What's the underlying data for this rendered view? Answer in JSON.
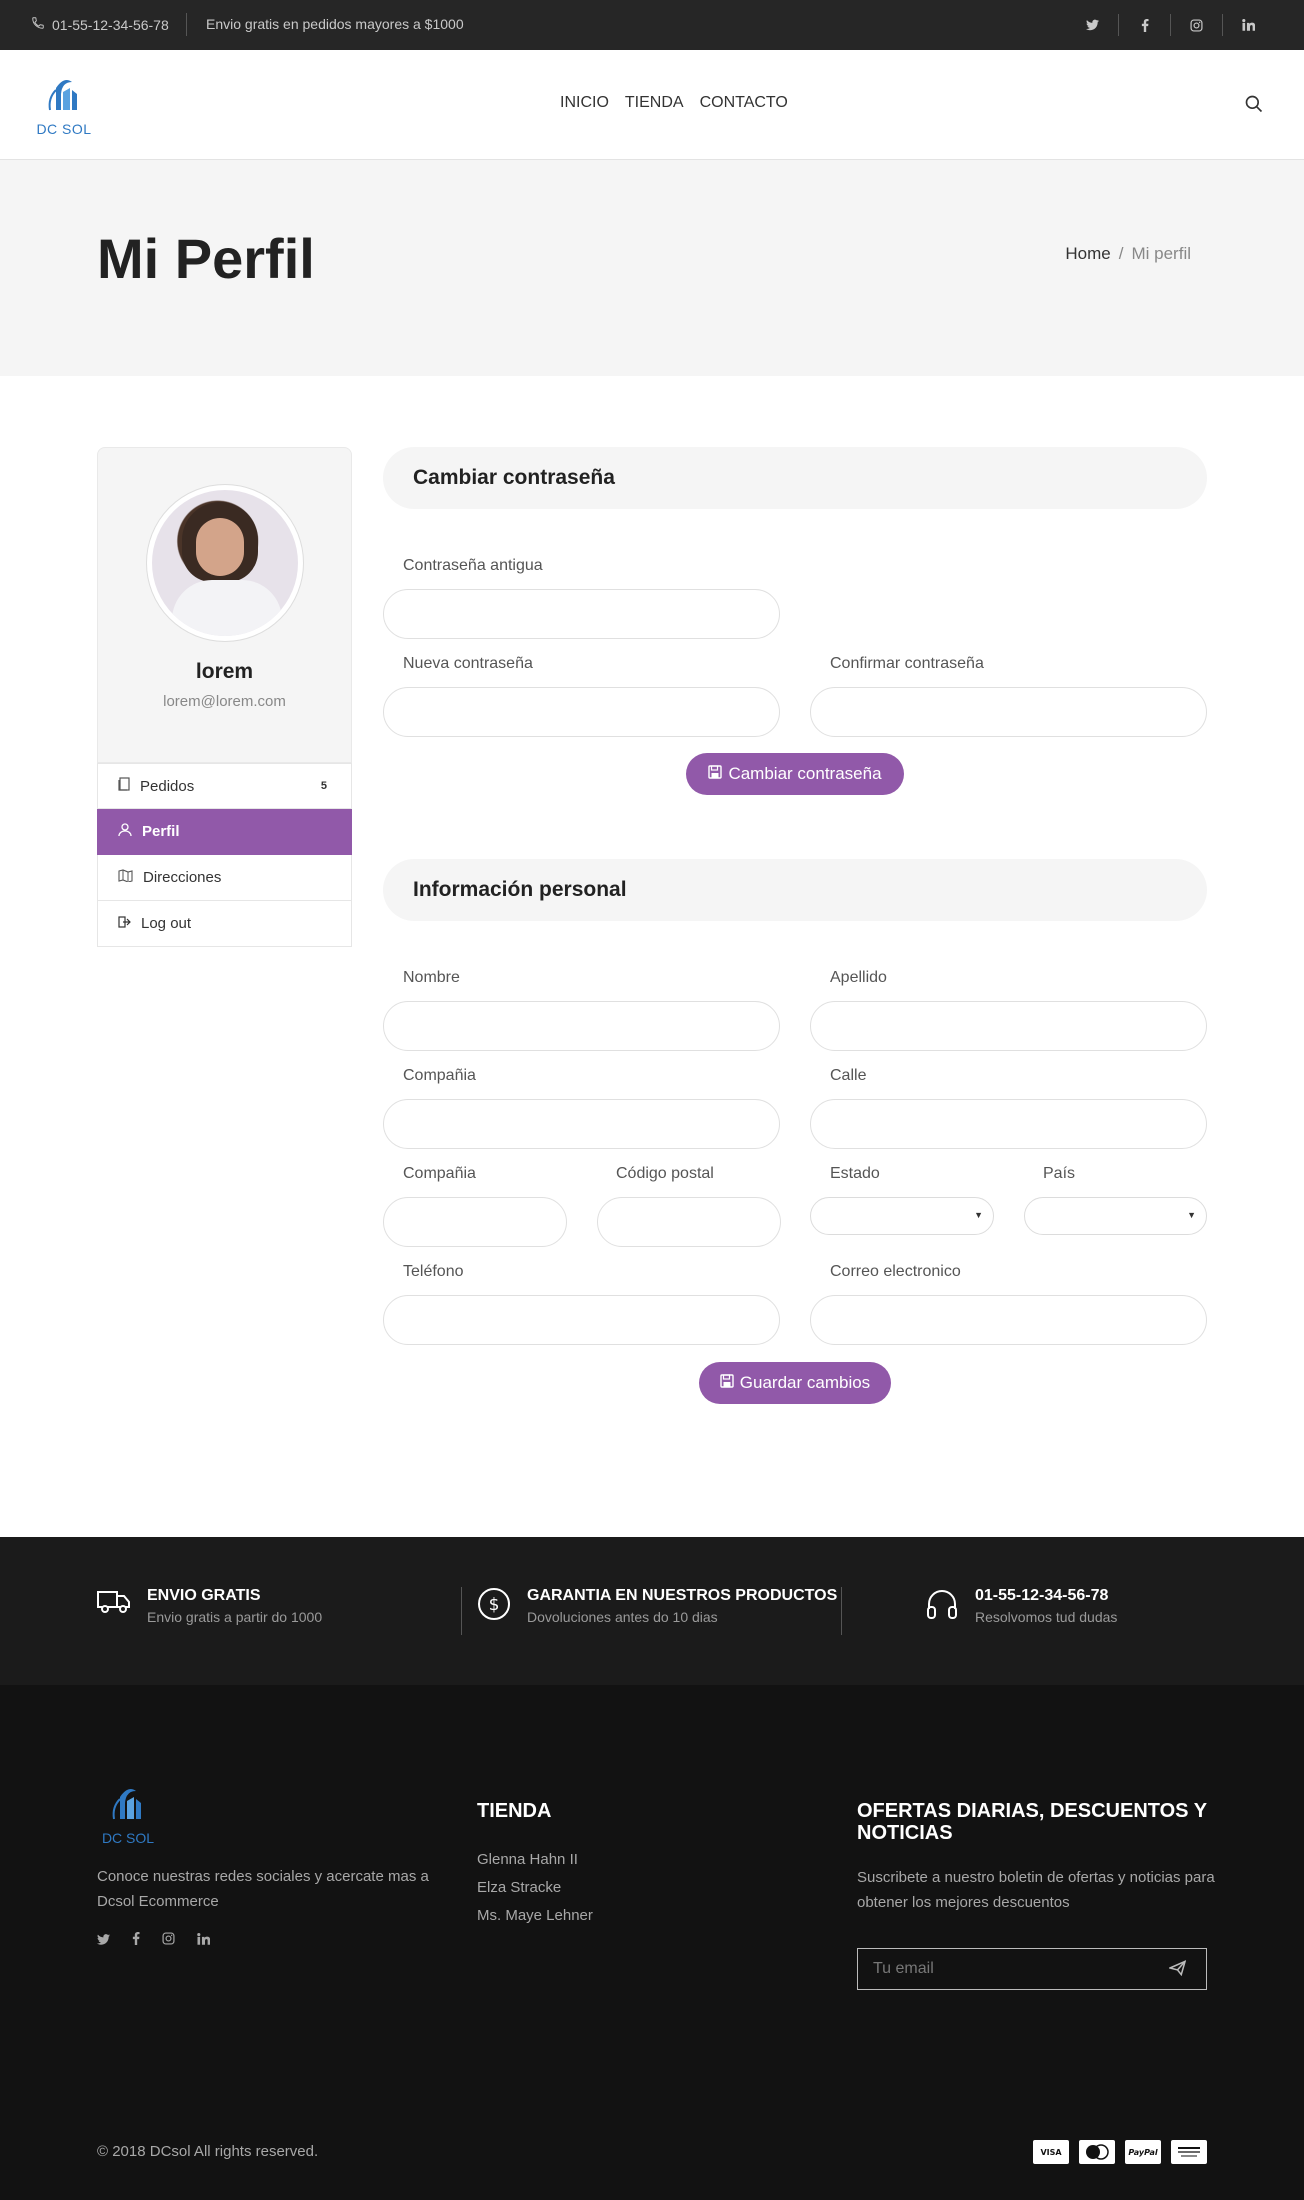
{
  "topbar": {
    "phone": "01-55-12-34-56-78",
    "shipping": "Envio gratis en pedidos mayores a $1000",
    "socials": [
      "twitter-icon",
      "facebook-icon",
      "instagram-icon",
      "linkedin-icon"
    ]
  },
  "header": {
    "logo_text": "DC SOL",
    "nav": [
      "INICIO",
      "TIENDA",
      "CONTACTO"
    ]
  },
  "page": {
    "title": "Mi Perfil",
    "breadcrumb": [
      "Home",
      "/",
      "Mi perfil"
    ]
  },
  "sidebar": {
    "name": "lorem",
    "email": "lorem@lorem.com",
    "menu": [
      {
        "label": "Pedidos",
        "badge": "5",
        "icon": "orders-icon"
      },
      {
        "label": "Perfil",
        "icon": "user-icon",
        "active": true
      },
      {
        "label": "Direcciones",
        "icon": "map-icon"
      },
      {
        "label": "Log out",
        "icon": "logout-icon"
      }
    ]
  },
  "password_section": {
    "title": "Cambiar contraseña",
    "old_label": "Contraseña antigua",
    "new_label": "Nueva contraseña",
    "confirm_label": "Confirmar contraseña",
    "button": "Cambiar contraseña"
  },
  "personal_section": {
    "title": "Información personal",
    "nombre_label": "Nombre",
    "apellido_label": "Apellido",
    "compania_label": "Compañia",
    "calle_label": "Calle",
    "compania2_label": "Compañia",
    "postal_label": "Código postal",
    "estado_label": "Estado",
    "pais_label": "País",
    "telefono_label": "Teléfono",
    "correo_label": "Correo electronico",
    "button": "Guardar cambios"
  },
  "features": [
    {
      "title": "ENVIO GRATIS",
      "desc": "Envio gratis a partir do 1000",
      "icon": "truck-icon"
    },
    {
      "title": "GARANTIA EN NUESTROS PRODUCTOS",
      "desc": "Dovoluciones antes do 10 dias",
      "icon": "dollar-icon"
    },
    {
      "title": "01-55-12-34-56-78",
      "desc": "Resolvomos tud dudas",
      "icon": "headphones-icon"
    }
  ],
  "footer": {
    "logo_text": "DC SOL",
    "desc": "Conoce nuestras redes sociales y acercate mas a Dcsol Ecommerce",
    "store_title": "TIENDA",
    "store_links": [
      "Glenna Hahn II",
      "Elza Stracke",
      "Ms. Maye Lehner"
    ],
    "news_title": "OFERTAS DIARIAS, DESCUENTOS Y NOTICIAS",
    "news_desc": "Suscribete a nuestro boletin de ofertas y noticias para obtener los mejores descuentos",
    "email_placeholder": "Tu email",
    "copyright": "© 2018 DCsol All rights reserved.",
    "cards": [
      "VISA",
      "MasterCard",
      "PayPal",
      "Discover"
    ]
  },
  "colors": {
    "accent": "#9159a9",
    "brand_blue": "#2f79c3",
    "topbar": "#262626",
    "footer": "#121212"
  }
}
